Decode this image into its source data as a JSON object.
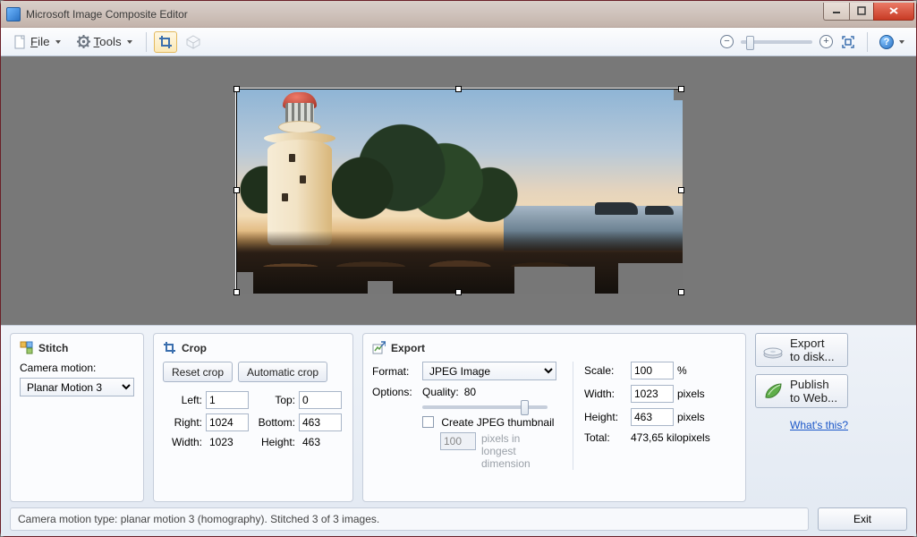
{
  "window": {
    "title": "Microsoft Image Composite Editor"
  },
  "toolbar": {
    "file_access": "F",
    "file_rest": "ile",
    "tools_access": "T",
    "tools_rest": "ools"
  },
  "panels": {
    "stitch": {
      "title": "Stitch",
      "camera_motion_label": "Camera motion:",
      "camera_motion_value": "Planar Motion 3"
    },
    "crop": {
      "title": "Crop",
      "reset_btn": "Reset crop",
      "auto_btn": "Automatic crop",
      "left_label": "Left:",
      "left_val": "1",
      "top_label": "Top:",
      "top_val": "0",
      "right_label": "Right:",
      "right_val": "1024",
      "bottom_label": "Bottom:",
      "bottom_val": "463",
      "width_label": "Width:",
      "width_val": "1023",
      "height_label": "Height:",
      "height_val": "463"
    },
    "export": {
      "title": "Export",
      "format_label": "Format:",
      "format_value": "JPEG Image",
      "options_label": "Options:",
      "quality_label": "Quality:",
      "quality_value": "80",
      "thumb_chk": "Create JPEG thumbnail",
      "thumb_px": "100",
      "thumb_px_hint": "pixels in longest dimension",
      "scale_label": "Scale:",
      "scale_val": "100",
      "scale_unit": "%",
      "width_label": "Width:",
      "width_val": "1023",
      "dim_unit": "pixels",
      "height_label": "Height:",
      "height_val": "463",
      "total_label": "Total:",
      "total_val": "473,65 kilopixels"
    }
  },
  "side": {
    "export_disk_l1": "Export",
    "export_disk_l2": "to disk...",
    "publish_l1": "Publish",
    "publish_l2": "to Web...",
    "whats_this": "What's this?"
  },
  "status": {
    "text": "Camera motion type: planar motion 3 (homography). Stitched 3 of 3 images.",
    "exit": "Exit"
  }
}
